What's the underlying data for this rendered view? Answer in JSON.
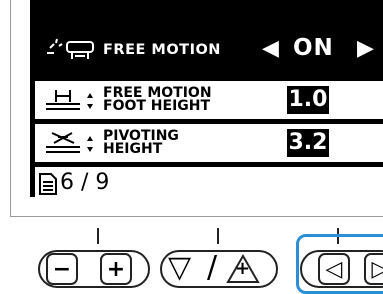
{
  "display": {
    "header": {
      "label": "FREE MOTION",
      "value": "ON",
      "left_arrow": "◀",
      "right_arrow": "▶"
    },
    "settings": [
      {
        "label_line1": "FREE MOTION",
        "label_line2": "FOOT HEIGHT",
        "value": "1.0",
        "icon": "presser-foot-height-icon"
      },
      {
        "label_line1": "PIVOTING",
        "label_line2": "HEIGHT",
        "value": "3.2",
        "icon": "pivoting-foot-icon"
      }
    ],
    "page": {
      "indicator": "6 / 9",
      "icon": "page-icon"
    }
  },
  "buttons": {
    "minus_symbol": "−",
    "plus_symbol": "+",
    "down_symbol": "▽",
    "slash": "/",
    "enter_symbol": "+",
    "left_symbol": "◁",
    "right_symbol": "▷"
  },
  "colors": {
    "highlight": "#2c8fd6",
    "lcd_dark": "#000000"
  }
}
